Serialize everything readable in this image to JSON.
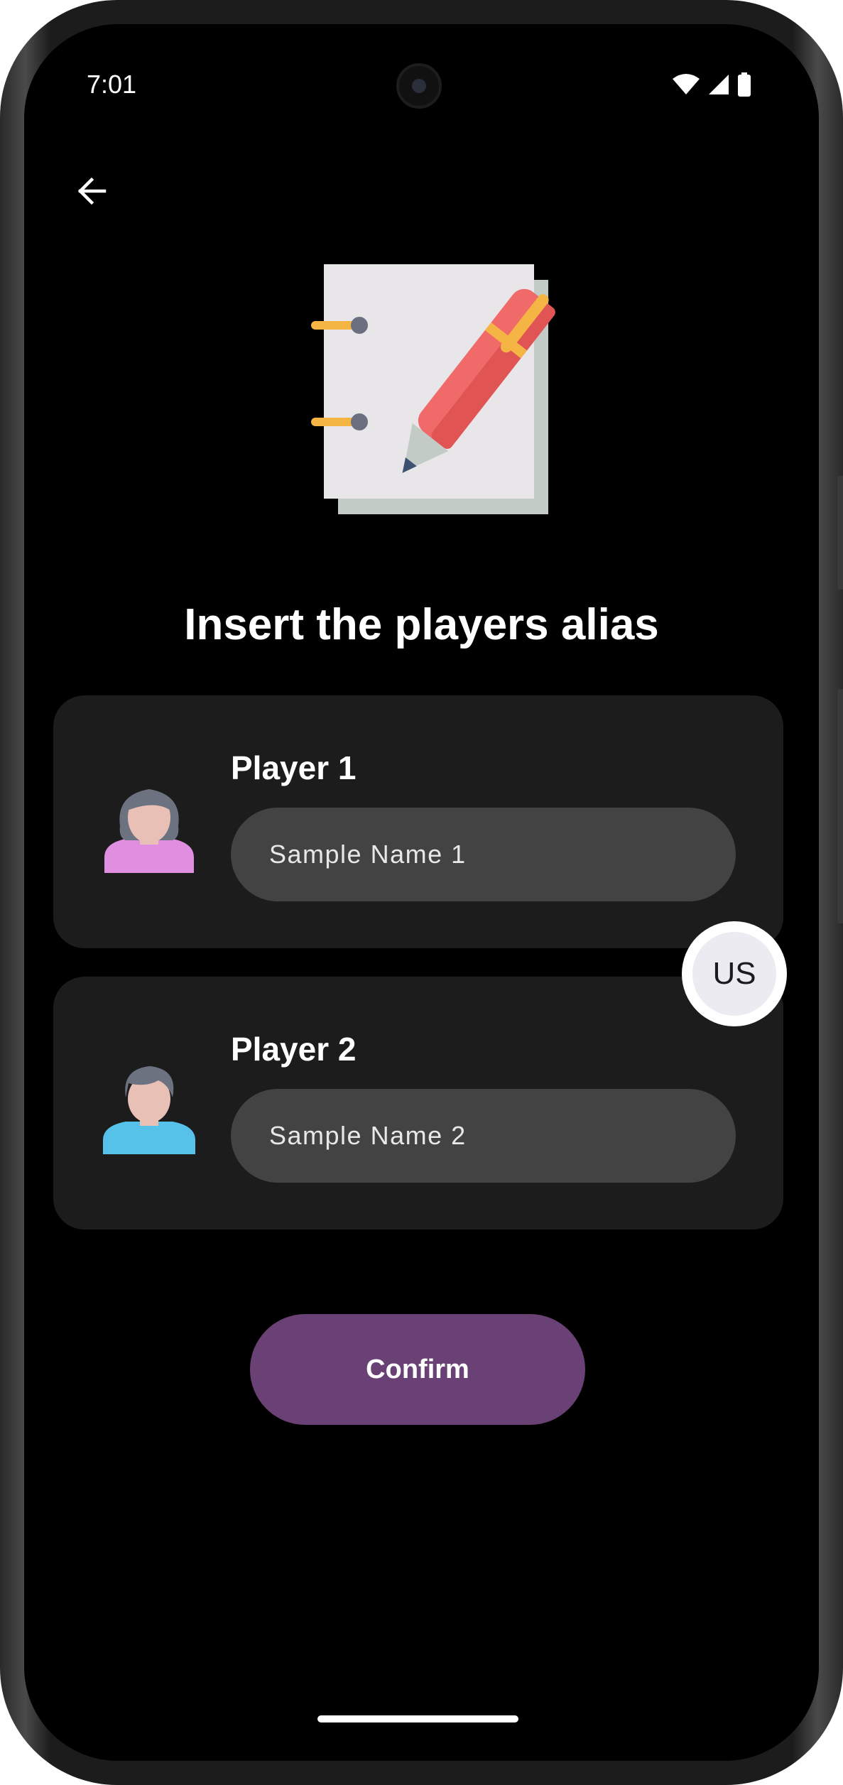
{
  "status_bar": {
    "time": "7:01",
    "icons": [
      "wifi-icon",
      "signal-icon",
      "battery-icon"
    ]
  },
  "header": {
    "back_icon": "arrow-left-icon",
    "illustration": "notebook-pen-illustration"
  },
  "title": "Insert the players alias",
  "players": [
    {
      "label": "Player 1",
      "value": "Sample Name 1",
      "avatar": "female-avatar-icon"
    },
    {
      "label": "Player 2",
      "value": "Sample Name 2",
      "avatar": "male-avatar-icon"
    }
  ],
  "language_bubble": {
    "label": "US"
  },
  "confirm_label": "Confirm",
  "colors": {
    "background": "#000000",
    "card": "#1c1c1c",
    "field": "#434343",
    "accent": "#6a4174"
  }
}
